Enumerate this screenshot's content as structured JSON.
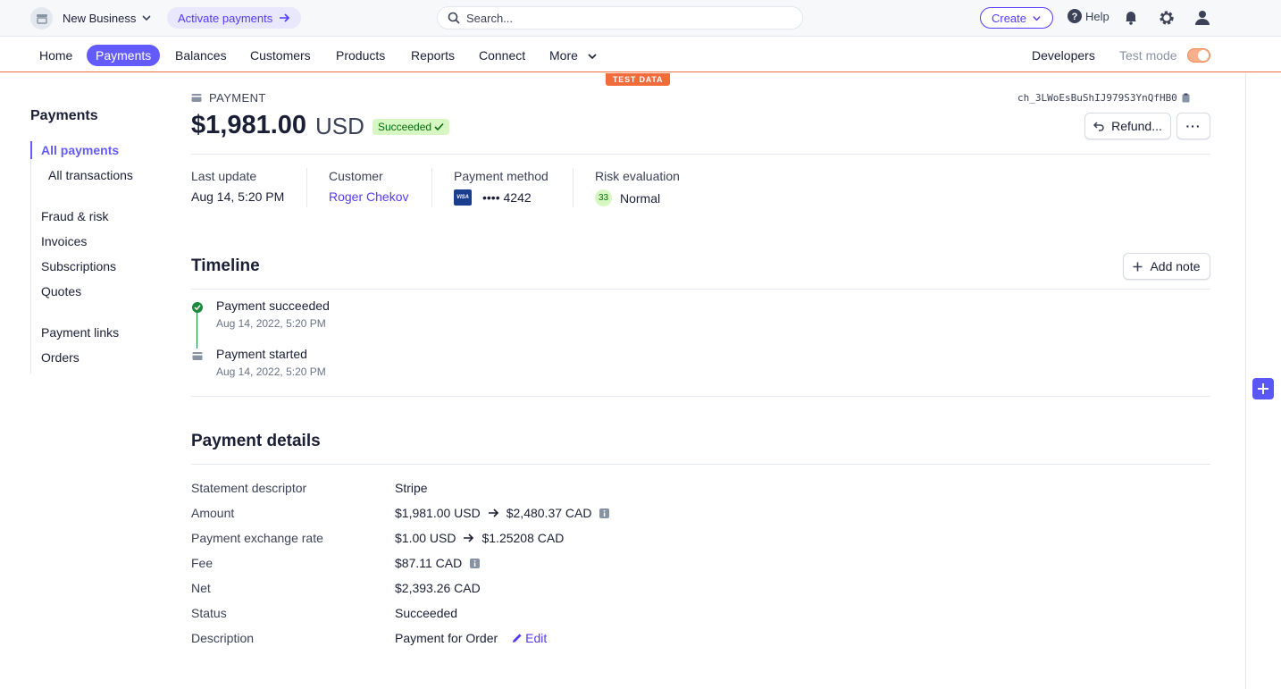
{
  "topbar": {
    "business_name": "New Business",
    "activate_label": "Activate payments",
    "search_placeholder": "Search...",
    "create_label": "Create",
    "help_label": "Help"
  },
  "nav": {
    "items": [
      "Home",
      "Payments",
      "Balances",
      "Customers",
      "Products",
      "Reports",
      "Connect",
      "More"
    ],
    "active": "Payments",
    "developers_label": "Developers",
    "test_mode_label": "Test mode",
    "test_mode_on": true,
    "test_data_badge": "TEST DATA"
  },
  "sidebar": {
    "title": "Payments",
    "items": [
      "All payments",
      "All transactions",
      "Fraud & risk",
      "Invoices",
      "Subscriptions",
      "Quotes",
      "Payment links",
      "Orders"
    ],
    "active": "All payments"
  },
  "payment": {
    "label": "PAYMENT",
    "charge_id": "ch_3LWoEsBuShIJ979S3YnQfHB0",
    "amount": "$1,981.00",
    "currency": "USD",
    "status": "Succeeded",
    "refund_label": "Refund...",
    "more_label": "···"
  },
  "summary": {
    "last_update_label": "Last update",
    "last_update_value": "Aug 14, 5:20 PM",
    "customer_label": "Customer",
    "customer_value": "Roger Chekov",
    "method_label": "Payment method",
    "method_value": "•••• 4242",
    "card_brand": "VISA",
    "risk_label": "Risk evaluation",
    "risk_score": "33",
    "risk_value": "Normal"
  },
  "timeline": {
    "title": "Timeline",
    "add_note_label": "Add note",
    "events": [
      {
        "title": "Payment succeeded",
        "time": "Aug 14, 2022, 5:20 PM"
      },
      {
        "title": "Payment started",
        "time": "Aug 14, 2022, 5:20 PM"
      }
    ]
  },
  "details": {
    "title": "Payment details",
    "rows": [
      {
        "label": "Statement descriptor",
        "value": "Stripe"
      },
      {
        "label": "Amount",
        "from": "$1,981.00 USD",
        "to": "$2,480.37 CAD"
      },
      {
        "label": "Payment exchange rate",
        "from": "$1.00 USD",
        "to": "$1.25208 CAD"
      },
      {
        "label": "Fee",
        "value": "$87.11 CAD"
      },
      {
        "label": "Net",
        "value": "$2,393.26 CAD"
      },
      {
        "label": "Status",
        "value": "Succeeded"
      },
      {
        "label": "Description",
        "value": "Payment for Order"
      }
    ],
    "edit_label": "Edit"
  },
  "colors": {
    "accent": "#635bff",
    "link": "#533afd",
    "success_bg": "#d7f7c2",
    "success_fg": "#05690d",
    "test_orange": "#f26b3a"
  }
}
